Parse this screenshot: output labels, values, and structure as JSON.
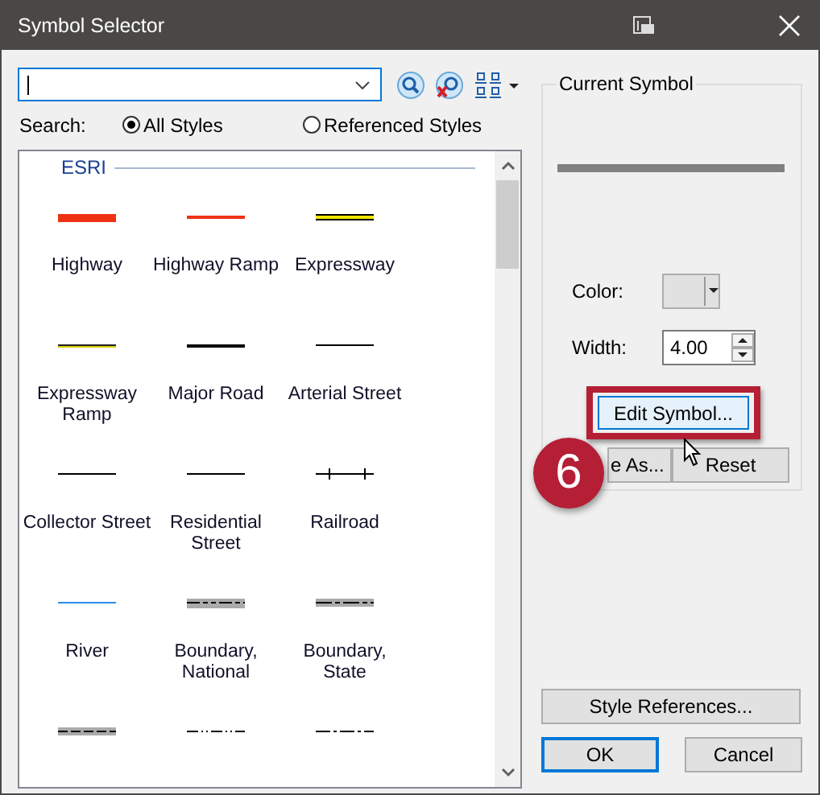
{
  "window": {
    "title": "Symbol Selector"
  },
  "search_scope": [
    {
      "label": "Search:"
    },
    {
      "label": "All Styles",
      "selected": true
    },
    {
      "label": "Referenced Styles",
      "selected": false
    }
  ],
  "gallery": {
    "group": "ESRI",
    "symbols": [
      {
        "label": "Highway",
        "kind": "thick-red"
      },
      {
        "label": "Highway Ramp",
        "kind": "thin-red"
      },
      {
        "label": "Expressway",
        "kind": "cased-yellow"
      },
      {
        "label": "Expressway Ramp",
        "kind": "yellow-line"
      },
      {
        "label": "Major Road",
        "kind": "thick-black"
      },
      {
        "label": "Arterial Street",
        "kind": "thin-black"
      },
      {
        "label": "Collector Street",
        "kind": "thin-black"
      },
      {
        "label": "Residential Street",
        "kind": "thin-black"
      },
      {
        "label": "Railroad",
        "kind": "railroad"
      },
      {
        "label": "River",
        "kind": "river"
      },
      {
        "label": "Boundary, National",
        "kind": "boundary-national"
      },
      {
        "label": "Boundary, State",
        "kind": "boundary-state"
      },
      {
        "kind": "boundary-county"
      },
      {
        "kind": "dash-dot-dot"
      },
      {
        "kind": "dash-dot"
      }
    ]
  },
  "current_symbol": {
    "title": "Current Symbol",
    "color_label": "Color:",
    "width_label": "Width:",
    "width_value": "4.00"
  },
  "buttons": {
    "edit": "Edit Symbol...",
    "save_as": "e As...",
    "reset": "Reset",
    "style_references": "Style References...",
    "ok": "OK",
    "cancel": "Cancel"
  },
  "callout": {
    "number": "6"
  }
}
